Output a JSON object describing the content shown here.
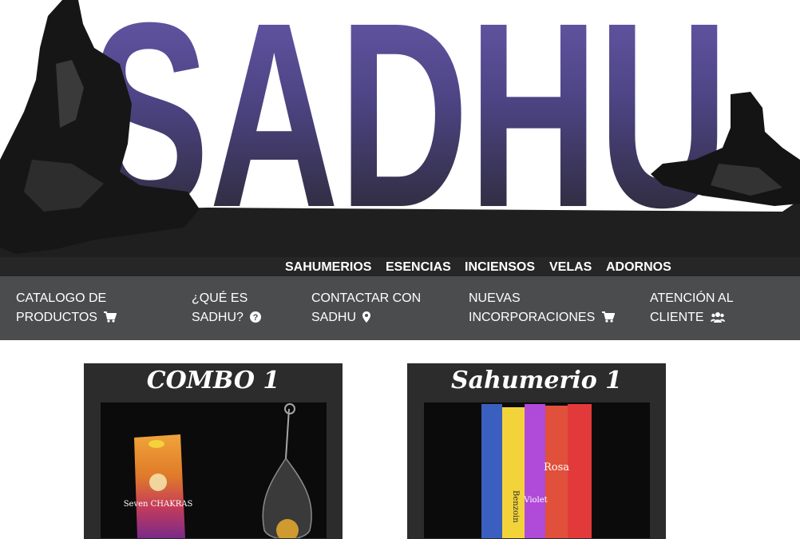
{
  "banner": {
    "logo_text": "SADHU"
  },
  "category_nav": {
    "items": [
      {
        "label": "SAHUMERIOS"
      },
      {
        "label": "ESENCIAS"
      },
      {
        "label": "INCIENSOS"
      },
      {
        "label": "VELAS"
      },
      {
        "label": "ADORNOS"
      }
    ]
  },
  "main_menu": {
    "items": [
      {
        "line1": "CATALOGO DE",
        "line2": "PRODUCTOS",
        "icon": "cart-icon"
      },
      {
        "line1": "¿QUÉ ES",
        "line2": "SADHU?",
        "icon": "question-circle-icon"
      },
      {
        "line1": "CONTACTAR CON",
        "line2": "SADHU",
        "icon": "map-marker-icon"
      },
      {
        "line1": "NUEVAS",
        "line2": "INCORPORACIONES",
        "icon": "cart-icon"
      },
      {
        "line1": "ATENCIÓN AL",
        "line2": "CLIENTE",
        "icon": "users-icon"
      }
    ]
  },
  "products": [
    {
      "title": "COMBO 1",
      "label_text": "Seven CHAKRAS"
    },
    {
      "title": "Sahumerio 1",
      "label_text_1": "Benzoin",
      "label_text_2": "Violet",
      "label_text_3": "Rosa"
    }
  ],
  "colors": {
    "logo_gradient_top": "#6b5bb0",
    "logo_gradient_bottom": "#1f1f1f",
    "nav_bg": "#262626",
    "menu_bg": "#4b4c4e",
    "card_bg": "#2c2c2c"
  }
}
